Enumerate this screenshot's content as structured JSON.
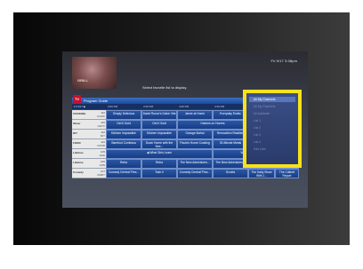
{
  "screen": {
    "datetime": "Fri 9/17  3:08pm",
    "preview_label": "GRILL",
    "instruction": "Select favorite list to display."
  },
  "guide": {
    "logo_text": "TV",
    "title": "Program Guide",
    "times": [
      "Fri 9/17 ▶",
      "3:00 PM",
      "3:30 PM",
      "4:00 PM",
      "4:30 PM"
    ],
    "rows": [
      {
        "logo": "COOKING",
        "num": "110",
        "callsign": "COOK",
        "programs": [
          "Simply Delicious",
          "David Rocco's Dolce Vita",
          "Jamie at Home",
          "Everyday Exotic"
        ]
      },
      {
        "logo": "Oliver",
        "num": "110",
        "callsign": "HGTV",
        "programs": [
          "Get It Sold",
          "Get It Sold",
          "Holmes on Homes"
        ]
      },
      {
        "logo": "DIY",
        "num": "110",
        "callsign": "DIY",
        "programs": [
          "Kitchen Impossible",
          "Kitchen Impossible",
          "Garage Mahal",
          "Renovation Realities"
        ]
      },
      {
        "logo": "FOOD",
        "num": "110",
        "callsign": "FOOD",
        "programs": [
          "Barefoot Contessa",
          "Down Home with the Nee...",
          "Paula's Home Cooking",
          "30-Minute Meals"
        ]
      },
      {
        "logo": "Lifetime",
        "num": "105",
        "callsign": "LIFE",
        "programs": [
          "What Girls Learn",
          "When Husbands Cheat"
        ]
      },
      {
        "logo": "Lifetime",
        "num": "106",
        "callsign": "LMN",
        "programs": [
          "Reba",
          "Reba",
          "The New Adventures...",
          "The New Adventures...",
          "The New Adventures...",
          "The New Adventures"
        ]
      },
      {
        "logo": "Comedy",
        "num": "107",
        "callsign": "CMDY",
        "programs": [
          "Comedy Central Pres...",
          "Tosh.0",
          "Comedy Central Pres...",
          "Scrubs",
          "The Daily Show With J...",
          "The Colbert Report"
        ]
      }
    ]
  },
  "favorites_menu": {
    "items": [
      "All My Channels",
      "All My Channels",
      "All Available",
      "List 1",
      "List 2",
      "List 3",
      "List 4",
      "Edit Lists"
    ],
    "selected_index": 0
  }
}
